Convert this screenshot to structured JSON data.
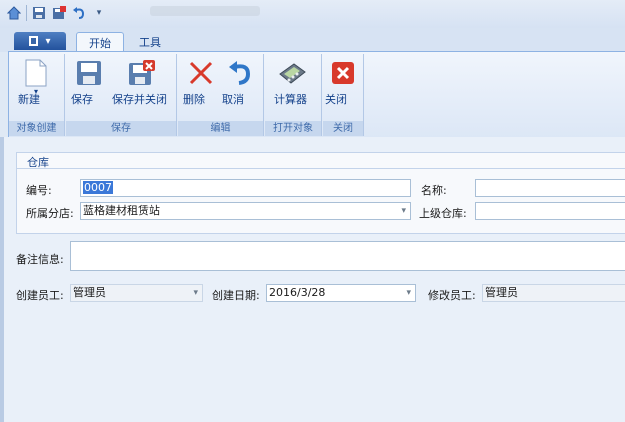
{
  "ribbon": {
    "tabs": [
      "开始",
      "工具"
    ],
    "groups": {
      "create": {
        "label": "对象创建",
        "new": "新建"
      },
      "save": {
        "label": "保存",
        "save": "保存",
        "save_close": "保存并关闭"
      },
      "edit": {
        "label": "编辑",
        "delete": "删除",
        "cancel": "取消"
      },
      "open": {
        "label": "打开对象",
        "calculator": "计算器"
      },
      "close": {
        "label": "关闭",
        "close": "关闭"
      }
    }
  },
  "panel": {
    "title": "仓库"
  },
  "form": {
    "code_label": "编号:",
    "code_value": "0007",
    "name_label": "名称:",
    "name_value": "",
    "branch_label": "所属分店:",
    "branch_value": "蓝格建材租赁站",
    "parent_label": "上级仓库:",
    "parent_value": "",
    "remark_label": "备注信息:",
    "remark_value": "",
    "creator_label": "创建员工:",
    "creator_value": "管理员",
    "created_date_label": "创建日期:",
    "created_date_value": "2016/3/28",
    "modifier_label": "修改员工:",
    "modifier_value": "管理员"
  }
}
